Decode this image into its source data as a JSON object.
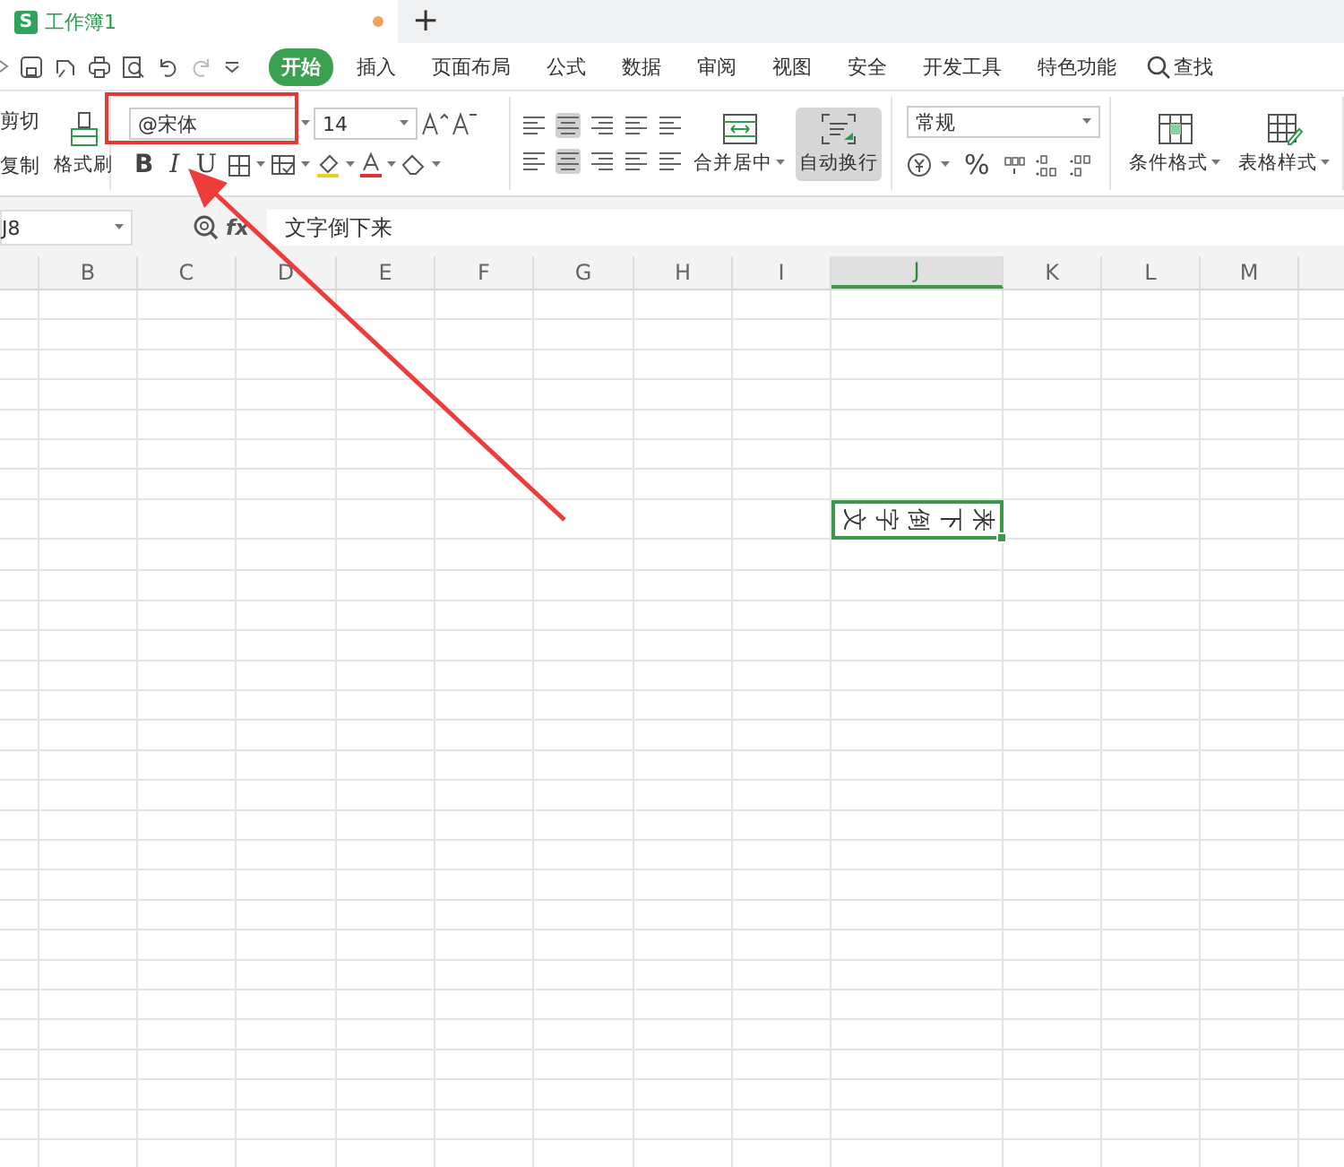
{
  "tab_bar": {
    "document_tab": {
      "app_badge": "S",
      "title": "工作簿1",
      "unsaved": true
    },
    "new_tab": "+"
  },
  "menu": [
    {
      "label": "开始",
      "selected": true
    },
    {
      "label": "插入",
      "selected": false
    },
    {
      "label": "页面布局",
      "selected": false
    },
    {
      "label": "公式",
      "selected": false
    },
    {
      "label": "数据",
      "selected": false
    },
    {
      "label": "审阅",
      "selected": false
    },
    {
      "label": "视图",
      "selected": false
    },
    {
      "label": "安全",
      "selected": false
    },
    {
      "label": "开发工具",
      "selected": false
    },
    {
      "label": "特色功能",
      "selected": false
    }
  ],
  "search": "查找",
  "ribbon": {
    "clipboard": {
      "cut": "剪切",
      "copy": "复制",
      "format_painter": "格式刷"
    },
    "font": {
      "font_name": "@宋体",
      "font_size": "14",
      "bold": "B",
      "italic": "I",
      "underline": "U"
    },
    "alignment": {
      "merge_center": "合并居中",
      "wrap_text": {
        "label": "自动换行",
        "on": true
      }
    },
    "number": {
      "format": "常规",
      "percent": "%"
    },
    "styles": {
      "conditional_format": "条件格式",
      "table_style": "表格样式"
    }
  },
  "formula_bar": {
    "name_box": "J8",
    "fx": "fx",
    "content": "文字倒下来"
  },
  "sheet": {
    "columns": [
      {
        "label": "B",
        "selected": false
      },
      {
        "label": "C",
        "selected": false
      },
      {
        "label": "D",
        "selected": false
      },
      {
        "label": "E",
        "selected": false
      },
      {
        "label": "F",
        "selected": false
      },
      {
        "label": "G",
        "selected": false
      },
      {
        "label": "H",
        "selected": false
      },
      {
        "label": "I",
        "selected": false
      },
      {
        "label": "J",
        "selected": true
      },
      {
        "label": "K",
        "selected": false
      },
      {
        "label": "L",
        "selected": false
      },
      {
        "label": "M",
        "selected": false
      }
    ],
    "active_cell_text": "文字倒下来"
  }
}
